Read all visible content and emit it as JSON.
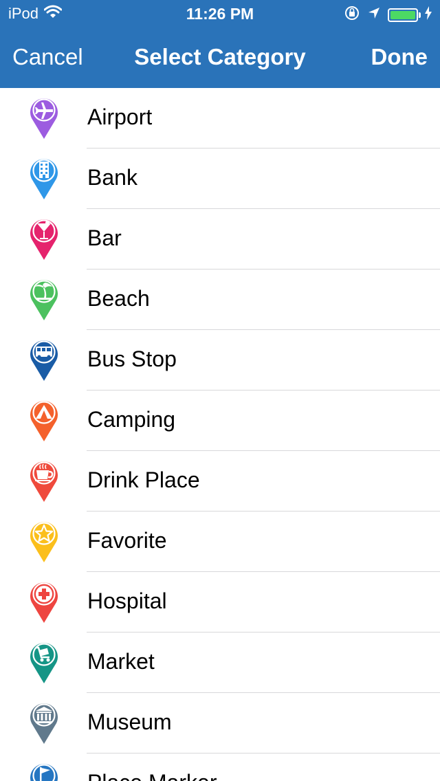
{
  "status_bar": {
    "carrier": "iPod",
    "time": "11:26 PM"
  },
  "nav": {
    "cancel_label": "Cancel",
    "title": "Select Category",
    "done_label": "Done"
  },
  "colors": {
    "header_bg": "#2a73b9",
    "battery": "#4cd964"
  },
  "categories": [
    {
      "label": "Airport",
      "icon": "airplane-icon",
      "color": "#9c5ce0"
    },
    {
      "label": "Bank",
      "icon": "bank-building-icon",
      "color": "#2f97e8"
    },
    {
      "label": "Bar",
      "icon": "cocktail-icon",
      "color": "#e5236d"
    },
    {
      "label": "Beach",
      "icon": "palm-tree-icon",
      "color": "#4cc15f"
    },
    {
      "label": "Bus Stop",
      "icon": "bus-icon",
      "color": "#1a5ca6"
    },
    {
      "label": "Camping",
      "icon": "tent-icon",
      "color": "#f4612c"
    },
    {
      "label": "Drink Place",
      "icon": "coffee-cup-icon",
      "color": "#ef4a3c"
    },
    {
      "label": "Favorite",
      "icon": "star-icon",
      "color": "#fbbf1c"
    },
    {
      "label": "Hospital",
      "icon": "medical-cross-icon",
      "color": "#ee4540"
    },
    {
      "label": "Market",
      "icon": "shopping-cart-icon",
      "color": "#159586"
    },
    {
      "label": "Museum",
      "icon": "museum-icon",
      "color": "#60798c"
    },
    {
      "label": "Place Marker",
      "icon": "flag-icon",
      "color": "#2576c2"
    }
  ]
}
